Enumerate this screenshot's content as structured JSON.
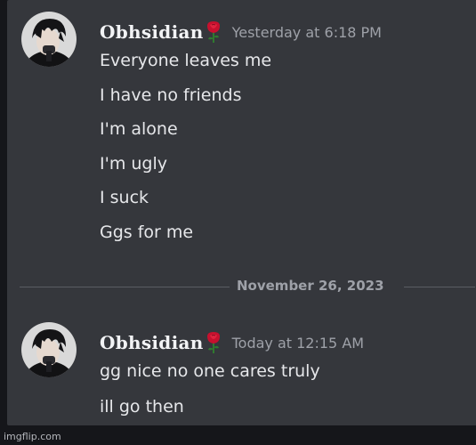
{
  "messages_top": {
    "username": "Obhsidian",
    "timestamp": "Yesterday at 6:18 PM",
    "avatar_icon": "avatar-dark-hair-icon",
    "badge_icon": "rose-icon",
    "lines": [
      "Everyone leaves me",
      "I have no friends",
      "I'm alone",
      "I'm ugly",
      "I suck",
      "Ggs for me"
    ]
  },
  "date_divider": {
    "label": "November 26, 2023"
  },
  "messages_bottom": {
    "username": "Obhsidian",
    "timestamp": "Today at 12:15 AM",
    "avatar_icon": "avatar-dark-hair-icon",
    "badge_icon": "rose-icon",
    "lines": [
      "gg nice no one cares truly",
      "ill go then"
    ]
  },
  "watermark": "imgflip.com",
  "colors": {
    "background": "#35373c",
    "outer_background": "#15161a",
    "username": "#f2f3f5",
    "timestamp": "#9ea1a8",
    "message_text": "#e6e7ea",
    "rose": "#c8102e"
  }
}
